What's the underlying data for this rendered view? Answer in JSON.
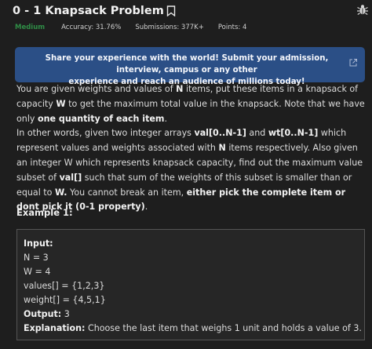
{
  "header": {
    "title": "0 - 1 Knapsack Problem"
  },
  "meta": {
    "difficulty": "Medium",
    "accuracy": "Accuracy: 31.76%",
    "submissions": "Submissions: 377K+",
    "points": "Points: 4"
  },
  "banner": {
    "line1": "Share your experience with the world! Submit your admission, interview, campus or any other",
    "line2": "experience and reach an audience of millions today!"
  },
  "description": {
    "p1_a": "You are given weights and values of ",
    "p1_n": "N",
    "p1_b": " items, put these items in a knapsack of capacity ",
    "p1_w": "W",
    "p1_c": " to get the maximum total value in the knapsack. Note that we have only ",
    "p1_bold": "one quantity of each item",
    "p1_d": ".",
    "p2_a": "In other words, given two integer arrays ",
    "p2_val": "val[0..N-1]",
    "p2_b": " and ",
    "p2_wt": "wt[0..N-1]",
    "p2_c": " which represent values and weights associated with ",
    "p2_n": "N",
    "p2_d": " items respectively. Also given an integer W which represents knapsack capacity, find out the maximum value subset of ",
    "p2_val2": "val[]",
    "p2_e": " such that sum of the weights of this subset is smaller than or equal to ",
    "p2_w": "W.",
    "p2_f": " You cannot break an item, ",
    "p2_bold": "either pick the complete item or dont pick it (0-1 property)",
    "p2_g": "."
  },
  "example": {
    "heading": "Example 1:",
    "input_label": "Input:",
    "n_line": "N = 3",
    "w_line": "W = 4",
    "values_line": "values[] = {1,2,3}",
    "weight_line": "weight[] = {4,5,1}",
    "output_label": "Output:",
    "output_value": " 3",
    "explanation_label": "Explanation:",
    "explanation_text": " Choose the last item that weighs 1 unit and holds a value of 3."
  },
  "icons": {
    "bookmark": "bookmark-icon",
    "bug": "bug-icon",
    "external": "external-link-icon"
  },
  "colors": {
    "background": "#1e1e1e",
    "difficulty": "#2f8d46",
    "banner": "#2b4f86"
  }
}
